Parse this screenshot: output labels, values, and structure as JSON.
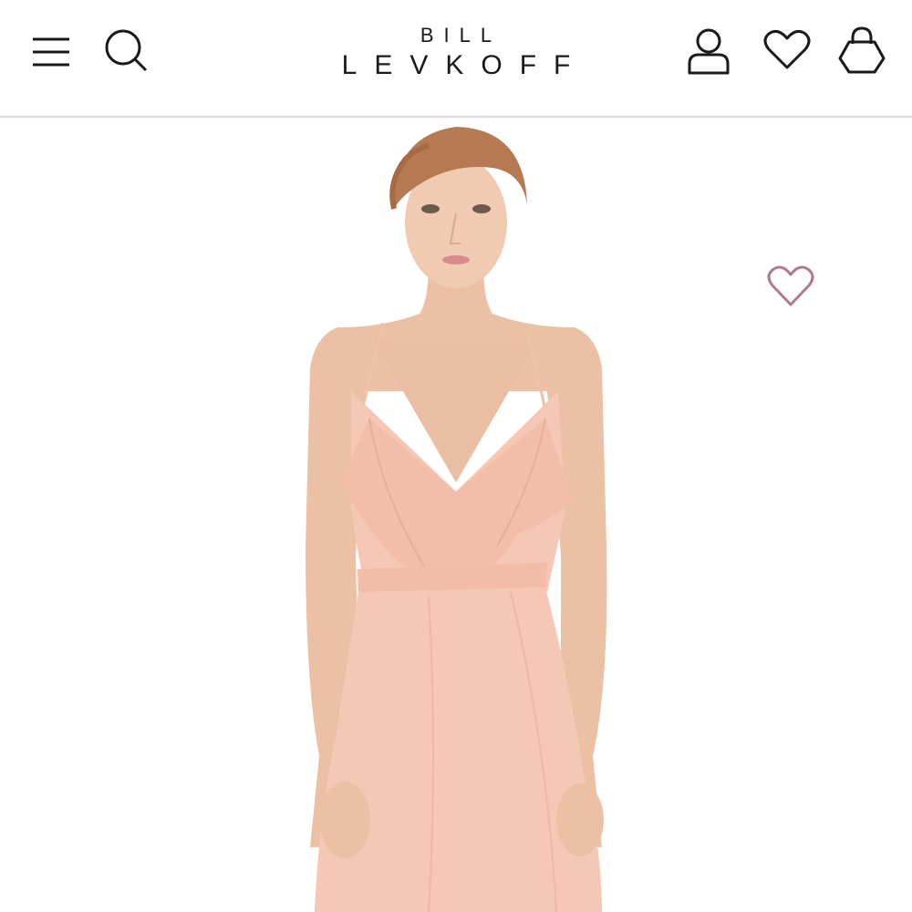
{
  "header": {
    "logo_top": "BILL",
    "logo_main": "LEVKOFF",
    "icons": [
      "menu-icon",
      "search-icon",
      "account-icon",
      "heart-icon",
      "shopping-bag-icon"
    ]
  },
  "product": {
    "image_description_icon": "product-photo",
    "favorite_icon": "heart-outline-icon"
  },
  "colors": {
    "header_bg": "#ffffff",
    "text": "#1a1a1a",
    "divider": "#dadada",
    "dress": "#f6c7b5",
    "favorite_heart": "#b07a8c"
  }
}
